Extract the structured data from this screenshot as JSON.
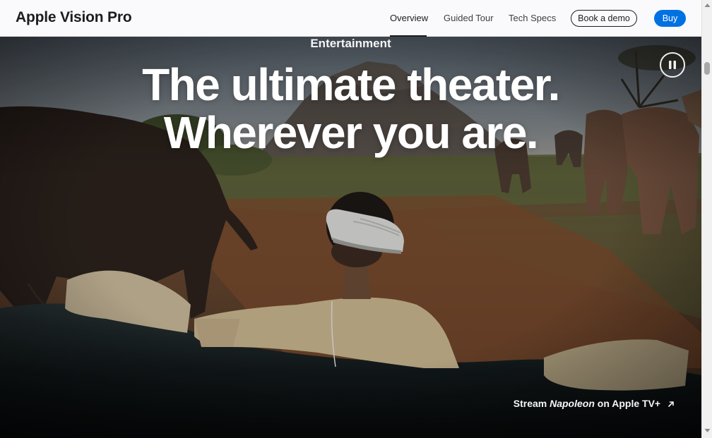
{
  "nav": {
    "product_title": "Apple Vision Pro",
    "links": [
      {
        "label": "Overview",
        "current": true
      },
      {
        "label": "Guided Tour",
        "current": false
      },
      {
        "label": "Tech Specs",
        "current": false
      }
    ],
    "demo_button": "Book a demo",
    "buy_button": "Buy"
  },
  "hero": {
    "eyebrow": "Entertainment",
    "headline_line1": "The ultimate theater.",
    "headline_line2": "Wherever you are.",
    "pause_icon": "pause-icon",
    "stream_prefix": "Stream ",
    "stream_title": "Napoleon",
    "stream_suffix": " on Apple TV+",
    "stream_icon": "arrow-up-right-icon"
  },
  "colors": {
    "nav_background": "#fafafc",
    "text_dark": "#1d1d1f",
    "buy_blue": "#0071e3",
    "hero_text": "#ffffff"
  }
}
